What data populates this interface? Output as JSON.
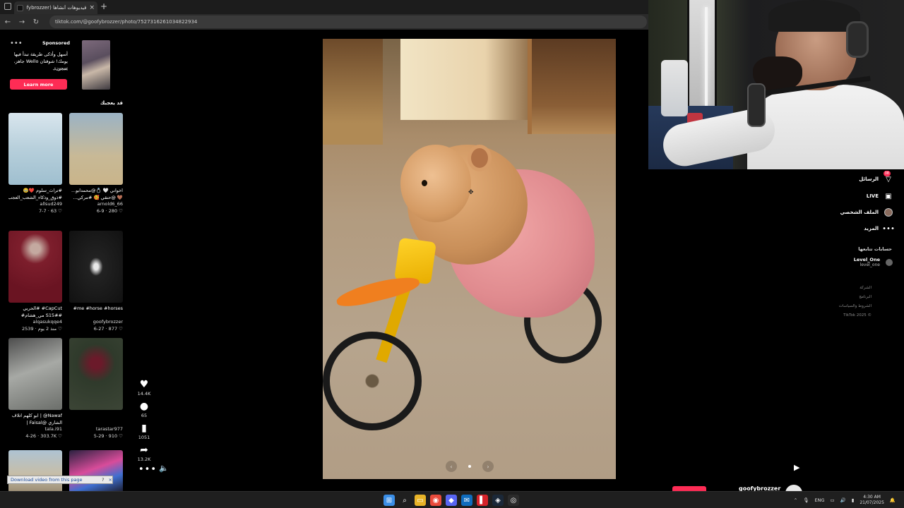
{
  "browser": {
    "tab_title": "فيديوهات أنشأها (goofybrozzer)",
    "tab_close": "×",
    "new_tab": "+",
    "url": "tiktok.com/@goofybrozzer/photo/7527316261034822934",
    "nav_back": "←",
    "nav_forward": "→",
    "nav_reload": "↻"
  },
  "sponsored": {
    "menu": "•••",
    "label": "Sponsored",
    "text": "أسهل وأذكى طريقة تبدأ فيها يومك! شوقتان Wello جاهز، صحي...",
    "advertiser": "Azooni",
    "cta": "Learn more"
  },
  "suggested": {
    "title": "قد يعجبك",
    "videos": [
      {
        "caption": "#تراث_سلوم ❤️🥹 #ذوق_وذكاء_الشعب_العجب",
        "user": "allsud249",
        "stats": "7-7 · 63 ♡"
      },
      {
        "caption": "اخواني 🤍 💍@محمدابو... 🤎 @حنقي 🥰 #مركي...",
        "user": "arnold6_66",
        "stats": "6-9 · 280 ♡"
      },
      {
        "caption": "CapCut# #الحربي #S15# مي_هشام# مودي...",
        "user": "alqasukqqe4",
        "stats": "2539 · منذ 2 يوم ♡"
      },
      {
        "caption": "me #horse #horses#",
        "user": "goofybrozzer",
        "stats": "6-27 · 877 ♡"
      },
      {
        "caption": "Nawaf@ | ابو كلهم اتلاف الشاري @Faisal | حسيت...",
        "user": "tala.i91",
        "stats": "4-26 · 303.7K ♡"
      },
      {
        "caption": "",
        "user": "tarastar977",
        "stats": "5-29 · 910 ♡"
      }
    ]
  },
  "download_bar": {
    "text": "Download video from this page",
    "help": "?",
    "close": "×"
  },
  "actions": {
    "likes": "14.4K",
    "comments": "65",
    "saves": "1051",
    "shares": "13.2K",
    "like_icon": "♥",
    "comment_icon": "●",
    "save_icon": "▮",
    "share_icon": "➦",
    "more_icon": "•••",
    "volume_icon": "🔈"
  },
  "photo_controls": {
    "prev": "‹",
    "next": "›"
  },
  "right_nav": [
    {
      "label": "الرسائل",
      "icon": "▽",
      "badge": "38"
    },
    {
      "label": "LIVE",
      "icon": "▣",
      "badge": ""
    },
    {
      "label": "الملف الشخصي",
      "icon": "",
      "badge": ""
    },
    {
      "label": "المزيد",
      "icon": "•••",
      "badge": ""
    }
  ],
  "following": {
    "title": "حسابات تتابعها",
    "accounts": [
      {
        "name": "Level_One",
        "handle": "level_one"
      }
    ]
  },
  "footer_links": [
    "الشركة",
    "البرنامج",
    "الشروط والسياسات",
    "TikTok 2025 ©"
  ],
  "bottom_bar": {
    "play_icon": "▶",
    "username": "goofybrozzer"
  },
  "taskbar": {
    "apps": [
      {
        "icon": "⊞",
        "color": "#3a8ee6"
      },
      {
        "icon": "⌕",
        "color": "#1f1f1f"
      },
      {
        "icon": "▭",
        "color": "#e8b428"
      },
      {
        "icon": "◉",
        "color": "#e94b3c"
      },
      {
        "icon": "◆",
        "color": "#5865f2"
      },
      {
        "icon": "✉",
        "color": "#0f6cbd"
      },
      {
        "icon": "▌",
        "color": "#d6232a"
      },
      {
        "icon": "◈",
        "color": "#1b2838"
      },
      {
        "icon": "◎",
        "color": "#2b2b2b"
      }
    ],
    "lang": "ENG",
    "time": "4:30 AM",
    "date": "21/07/2025",
    "tray_up": "⌃"
  }
}
